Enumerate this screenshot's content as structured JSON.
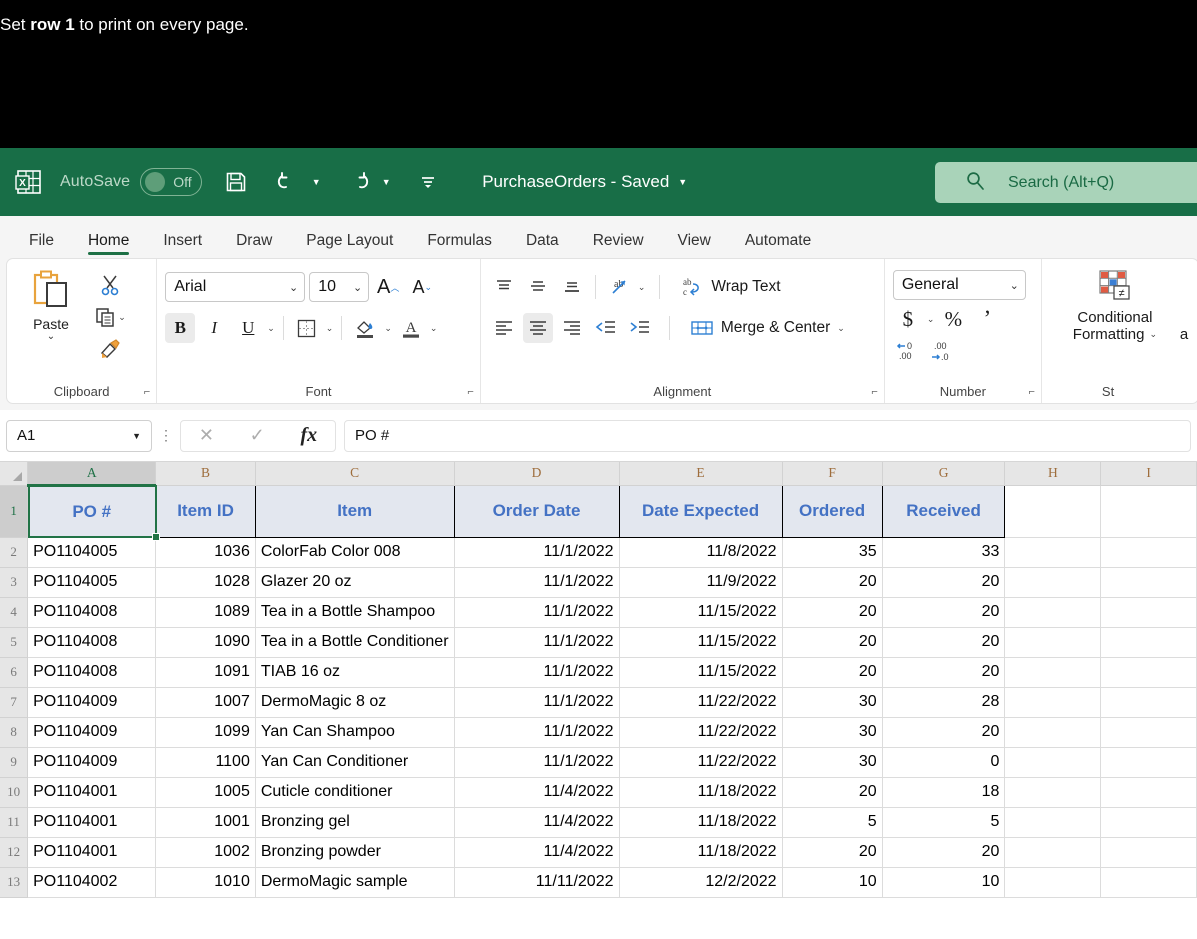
{
  "banner": {
    "prefix": "Set ",
    "bold": "row 1",
    "suffix": " to print on every page."
  },
  "titlebar": {
    "autosave_label": "AutoSave",
    "autosave_state": "Off",
    "save_icon": "save-icon",
    "undo_icon": "undo-icon",
    "redo_icon": "redo-icon",
    "qat_more_icon": "quick-access-more-icon",
    "document_title": "PurchaseOrders - Saved",
    "search_placeholder": "Search (Alt+Q)",
    "brand_color": "#186e47",
    "search_bg": "#a9d3b9"
  },
  "ribbon": {
    "tabs": [
      {
        "label": "File",
        "active": false
      },
      {
        "label": "Home",
        "active": true
      },
      {
        "label": "Insert",
        "active": false
      },
      {
        "label": "Draw",
        "active": false
      },
      {
        "label": "Page Layout",
        "active": false
      },
      {
        "label": "Formulas",
        "active": false
      },
      {
        "label": "Data",
        "active": false
      },
      {
        "label": "Review",
        "active": false
      },
      {
        "label": "View",
        "active": false
      },
      {
        "label": "Automate",
        "active": false
      }
    ],
    "clipboard": {
      "group_label": "Clipboard",
      "paste_label": "Paste",
      "cut_icon": "scissors-icon",
      "copy_icon": "copy-icon",
      "format_painter_icon": "format-painter-icon"
    },
    "font": {
      "group_label": "Font",
      "font_name": "Arial",
      "font_size": "10",
      "grow_font": "A",
      "shrink_font": "A",
      "bold": "B",
      "italic": "I",
      "underline": "U",
      "borders_icon": "borders-icon",
      "fill_color_icon": "fill-color-icon",
      "font_color_icon": "font-color-icon",
      "bold_active": true
    },
    "alignment": {
      "group_label": "Alignment",
      "align_top_icon": "align-top-icon",
      "align_middle_icon": "align-middle-icon",
      "align_bottom_icon": "align-bottom-icon",
      "orientation_icon": "orientation-icon",
      "wrap_text_label": "Wrap Text",
      "wrap_text_icon": "wrap-text-icon",
      "align_left_icon": "align-left-icon",
      "align_center_icon": "align-center-icon",
      "align_right_icon": "align-right-icon",
      "decrease_indent_icon": "decrease-indent-icon",
      "increase_indent_icon": "increase-indent-icon",
      "merge_center_label": "Merge & Center",
      "merge_center_icon": "merge-center-icon",
      "center_active": true
    },
    "number": {
      "group_label": "Number",
      "format": "General",
      "currency": "$",
      "percent": "%",
      "comma": "’",
      "decrease_decimal_icon": "decrease-decimal-icon",
      "increase_decimal_icon": "increase-decimal-icon"
    },
    "styles": {
      "group_label": "St",
      "conditional_formatting_line1": "Conditional",
      "conditional_formatting_line2": "Formatting",
      "next_item_partial": "a"
    }
  },
  "formulabar": {
    "name_box": "A1",
    "cancel_icon": "cancel-icon",
    "confirm_icon": "confirm-icon",
    "function_icon": "fx-icon",
    "content": "PO #"
  },
  "grid": {
    "columns": [
      "A",
      "B",
      "C",
      "D",
      "E",
      "F",
      "G",
      "H",
      "I"
    ],
    "selected_column": "A",
    "selected_cell": "A1",
    "row_numbers": [
      "1",
      "2",
      "3",
      "4",
      "5",
      "6",
      "7",
      "8",
      "9",
      "10",
      "11",
      "12",
      "13"
    ],
    "headers": [
      "PO #",
      "Item ID",
      "Item",
      "Order Date",
      "Date Expected",
      "Ordered",
      "Received"
    ],
    "rows": [
      [
        "PO1104005",
        "1036",
        "ColorFab Color 008",
        "11/1/2022",
        "11/8/2022",
        "35",
        "33"
      ],
      [
        "PO1104005",
        "1028",
        "Glazer 20 oz",
        "11/1/2022",
        "11/9/2022",
        "20",
        "20"
      ],
      [
        "PO1104008",
        "1089",
        "Tea in a Bottle Shampoo",
        "11/1/2022",
        "11/15/2022",
        "20",
        "20"
      ],
      [
        "PO1104008",
        "1090",
        "Tea in a Bottle Conditioner",
        "11/1/2022",
        "11/15/2022",
        "20",
        "20"
      ],
      [
        "PO1104008",
        "1091",
        "TIAB 16 oz",
        "11/1/2022",
        "11/15/2022",
        "20",
        "20"
      ],
      [
        "PO1104009",
        "1007",
        "DermoMagic 8 oz",
        "11/1/2022",
        "11/22/2022",
        "30",
        "28"
      ],
      [
        "PO1104009",
        "1099",
        "Yan Can Shampoo",
        "11/1/2022",
        "11/22/2022",
        "30",
        "20"
      ],
      [
        "PO1104009",
        "1100",
        "Yan Can Conditioner",
        "11/1/2022",
        "11/22/2022",
        "30",
        "0"
      ],
      [
        "PO1104001",
        "1005",
        "Cuticle conditioner",
        "11/4/2022",
        "11/18/2022",
        "20",
        "18"
      ],
      [
        "PO1104001",
        "1001",
        "Bronzing gel",
        "11/4/2022",
        "11/18/2022",
        "5",
        "5"
      ],
      [
        "PO1104001",
        "1002",
        "Bronzing powder",
        "11/4/2022",
        "11/18/2022",
        "20",
        "20"
      ],
      [
        "PO1104002",
        "1010",
        "DermoMagic sample",
        "11/11/2022",
        "12/2/2022",
        "10",
        "10"
      ]
    ],
    "header_fill": "#e3e7ef",
    "header_text_color": "#4472c4",
    "selection_color": "#217346"
  }
}
